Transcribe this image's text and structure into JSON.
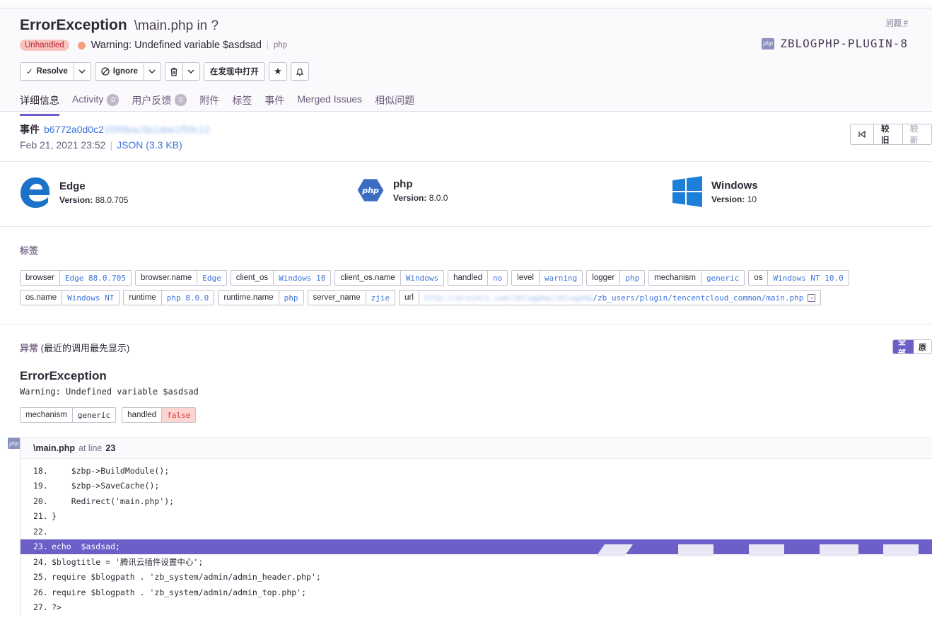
{
  "header": {
    "title": "ErrorException",
    "subtitle": "\\main.php in ?",
    "badge": "Unhandled",
    "message": "Warning: Undefined variable $asdsad",
    "platform": "php",
    "issue_label": "问题 #",
    "issue_id": "ZBLOGPHP-PLUGIN-8",
    "php_icon_text": "php"
  },
  "actions": {
    "resolve": "Resolve",
    "ignore": "Ignore",
    "open_in_discover": "在发现中打开"
  },
  "tabs": [
    {
      "label": "详细信息",
      "count": null
    },
    {
      "label": "Activity",
      "count": "0"
    },
    {
      "label": "用户反馈",
      "count": "0"
    },
    {
      "label": "附件",
      "count": null
    },
    {
      "label": "标签",
      "count": null
    },
    {
      "label": "事件",
      "count": null
    },
    {
      "label": "Merged Issues",
      "count": null
    },
    {
      "label": "相似问题",
      "count": null
    }
  ],
  "event": {
    "label": "事件",
    "id": "b6772a0d0c2",
    "id_obscured": "1f0f9bac5b1abe1f59c12",
    "date": "Feb 21, 2021 23:52",
    "json_link": "JSON (3.3 KB)",
    "nav_older": "较旧",
    "nav_newer": "较新"
  },
  "contexts": [
    {
      "name": "Edge",
      "version_label": "Version:",
      "version": "88.0.705"
    },
    {
      "name": "php",
      "version_label": "Version:",
      "version": "8.0.0"
    },
    {
      "name": "Windows",
      "version_label": "Version:",
      "version": "10"
    }
  ],
  "tags_title": "标签",
  "tags": [
    {
      "key": "browser",
      "value": "Edge 88.0.705"
    },
    {
      "key": "browser.name",
      "value": "Edge"
    },
    {
      "key": "client_os",
      "value": "Windows 10"
    },
    {
      "key": "client_os.name",
      "value": "Windows"
    },
    {
      "key": "handled",
      "value": "no"
    },
    {
      "key": "level",
      "value": "warning"
    },
    {
      "key": "logger",
      "value": "php"
    },
    {
      "key": "mechanism",
      "value": "generic"
    },
    {
      "key": "os",
      "value": "Windows NT 10.0"
    },
    {
      "key": "os.name",
      "value": "Windows NT"
    },
    {
      "key": "runtime",
      "value": "php 8.0.0"
    },
    {
      "key": "runtime.name",
      "value": "php"
    },
    {
      "key": "server_name",
      "value": "zjie"
    },
    {
      "key": "url",
      "value_obscured": "http://project.com/zblogphp/zblogphp",
      "value": "/zb_users/plugin/tencentcloud_common/main.php"
    }
  ],
  "exception": {
    "section_title": "异常",
    "section_note": "(最近的调用最先显示)",
    "toggle_all": "全部",
    "toggle_raw": "原",
    "title": "ErrorException",
    "message": "Warning: Undefined variable $asdsad",
    "mechanism_key": "mechanism",
    "mechanism_value": "generic",
    "handled_key": "handled",
    "handled_value": "false"
  },
  "frame": {
    "file": "\\main.php",
    "at_line_text": "at line",
    "line": "23",
    "code": [
      {
        "n": "18.",
        "text": "    $zbp->BuildModule();"
      },
      {
        "n": "19.",
        "text": "    $zbp->SaveCache();"
      },
      {
        "n": "20.",
        "text": "    Redirect('main.php');"
      },
      {
        "n": "21.",
        "text": "}"
      },
      {
        "n": "22.",
        "text": ""
      },
      {
        "n": "23.",
        "text": "echo  $asdsad;",
        "active": true
      },
      {
        "n": "24.",
        "text": "$blogtitle = '腾讯云插件设置中心';"
      },
      {
        "n": "25.",
        "text": "require $blogpath . 'zb_system/admin/admin_header.php';"
      },
      {
        "n": "26.",
        "text": "require $blogpath . 'zb_system/admin/admin_top.php';"
      },
      {
        "n": "27.",
        "text": "?>"
      }
    ]
  },
  "colors": {
    "accent": "#6c5fc7",
    "link": "#3d74db",
    "unhandled_bg": "#f9c3bd",
    "warning_dot": "#f2a07e"
  }
}
